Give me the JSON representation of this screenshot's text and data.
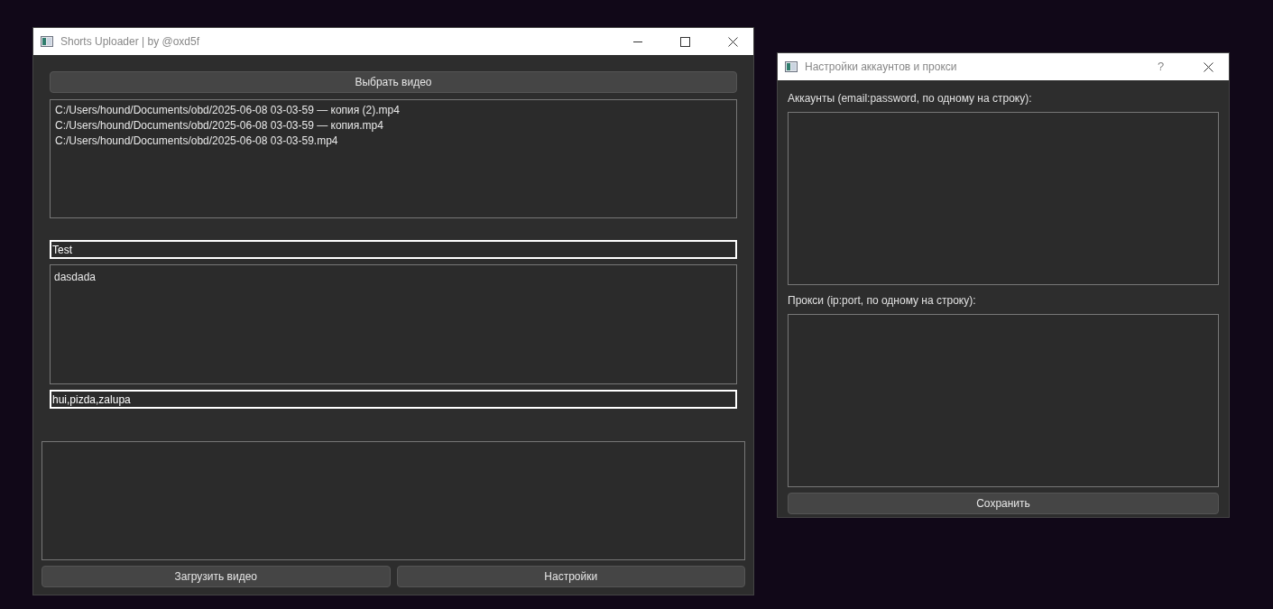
{
  "main_window": {
    "title": "Shorts Uploader | by @oxd5f",
    "choose_button": "Выбрать видео",
    "files": [
      {
        "path": "C:/Users/hound/Documents/obd/2025-06-08 03-03-59 — копия (2).mp4"
      },
      {
        "path": "C:/Users/hound/Documents/obd/2025-06-08 03-03-59 — копия.mp4"
      },
      {
        "path": "C:/Users/hound/Documents/obd/2025-06-08 03-03-59.mp4"
      }
    ],
    "title_field": {
      "value": "Test"
    },
    "description_field": {
      "value": "dasdada"
    },
    "tags_field": {
      "value": "hui,pizda,zalupa"
    },
    "buttons": [
      "Загрузить видео",
      "Настройки"
    ]
  },
  "settings_dialog": {
    "title": "Настройки аккаунтов и прокси",
    "help_button": "?",
    "accounts_label": "Аккаунты (email:password, по одному на строку):",
    "proxies_label": "Прокси (ip:port, по одному на строку):",
    "save_button": "Сохранить"
  }
}
